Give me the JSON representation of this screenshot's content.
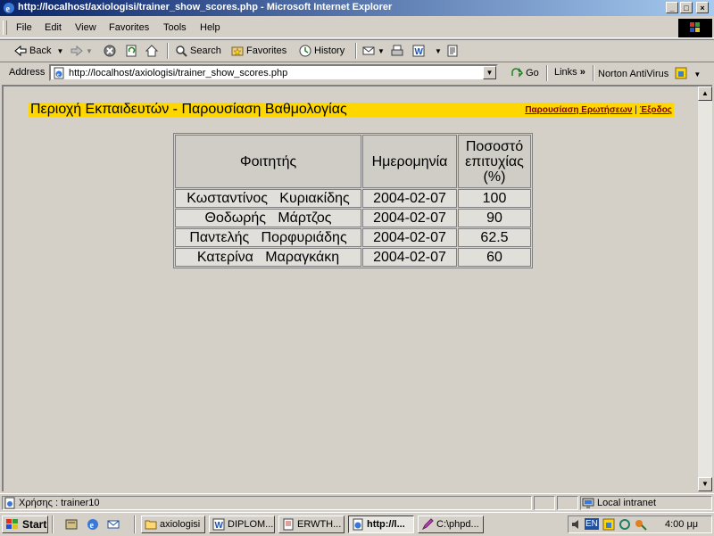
{
  "window": {
    "title": "http://localhost/axiologisi/trainer_show_scores.php - Microsoft Internet Explorer"
  },
  "menu": [
    "File",
    "Edit",
    "View",
    "Favorites",
    "Tools",
    "Help"
  ],
  "toolbar": {
    "back": "Back",
    "search": "Search",
    "favorites": "Favorites",
    "history": "History"
  },
  "address": {
    "label": "Address",
    "url": "http://localhost/axiologisi/trainer_show_scores.php",
    "go": "Go",
    "links": "Links",
    "norton": "Norton AntiVirus"
  },
  "page": {
    "title": "Περιοχή Εκπαιδευτών - Παρουσίαση Βαθμολογίας",
    "links": {
      "questions": "Παρουσίαση Ερωτήσεων",
      "separator": "|",
      "exit": "Έξοδος"
    },
    "accent_color": "#ffd700",
    "link_color": "#800000",
    "table": {
      "headers": [
        "Φοιτητής",
        "Ημερομηνία",
        "Ποσοστό επιτυχίας (%)"
      ],
      "rows": [
        [
          "Κωσταντίνος   Κυριακίδης",
          "2004-02-07",
          "100"
        ],
        [
          "Θοδωρής   Μάρτζος",
          "2004-02-07",
          "90"
        ],
        [
          "Παντελής   Πορφυριάδης",
          "2004-02-07",
          "62.5"
        ],
        [
          "Κατερίνα   Μαραγκάκη",
          "2004-02-07",
          "60"
        ]
      ]
    }
  },
  "status": {
    "text": "Χρήσης : trainer10",
    "zone": "Local intranet"
  },
  "taskbar": {
    "start": "Start",
    "tasks": [
      "axiologisi",
      "DIPLOM...",
      "ERWTH...",
      "http://l...",
      "C:\\phpd..."
    ],
    "language": "EN",
    "clock": "4:00 μμ"
  },
  "icons": [
    "ie-icon",
    "back-arrow-icon",
    "forward-arrow-icon",
    "stop-icon",
    "refresh-icon",
    "home-icon",
    "search-icon",
    "favorites-icon",
    "history-icon",
    "mail-icon",
    "print-icon",
    "edit-icon",
    "discuss-icon",
    "page-icon",
    "go-arrow-icon",
    "norton-icon",
    "scroll-up-icon",
    "scroll-down-icon",
    "windows-logo-icon"
  ]
}
